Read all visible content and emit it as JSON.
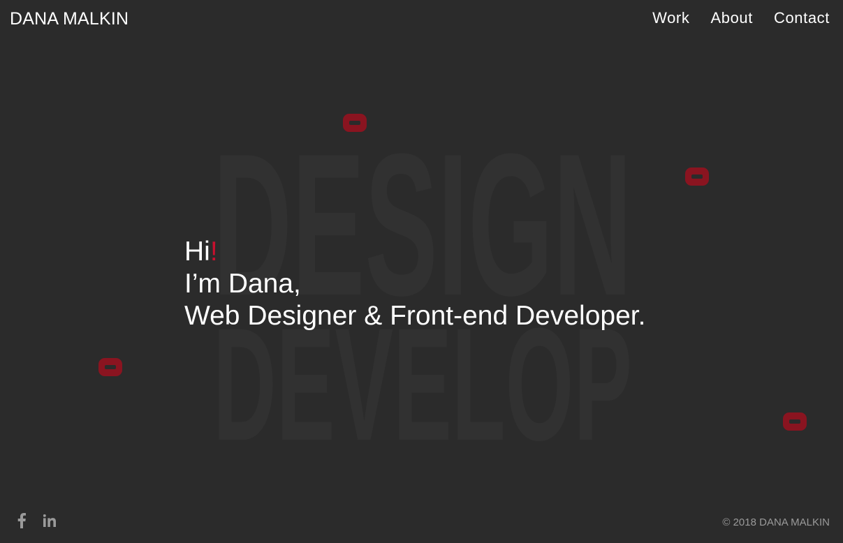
{
  "header": {
    "logo": "DANA MALKIN",
    "nav": [
      {
        "label": "Work"
      },
      {
        "label": "About"
      },
      {
        "label": "Contact"
      }
    ]
  },
  "background": {
    "word_top": "DESIGN",
    "word_bottom": "DEVELOP"
  },
  "hero": {
    "greeting": "Hi",
    "greeting_mark": "!",
    "line2": "I’m Dana,",
    "line3": "Web Designer & Front-end Developer."
  },
  "footer": {
    "social": [
      {
        "icon": "facebook-icon"
      },
      {
        "icon": "linkedin-icon"
      }
    ],
    "copyright": "© 2018 DANA MALKIN"
  },
  "colors": {
    "background": "#2b2b2b",
    "accent": "#c8102e",
    "decoration": "#8a1420",
    "text": "#ffffff",
    "muted": "#9a9a9a"
  }
}
